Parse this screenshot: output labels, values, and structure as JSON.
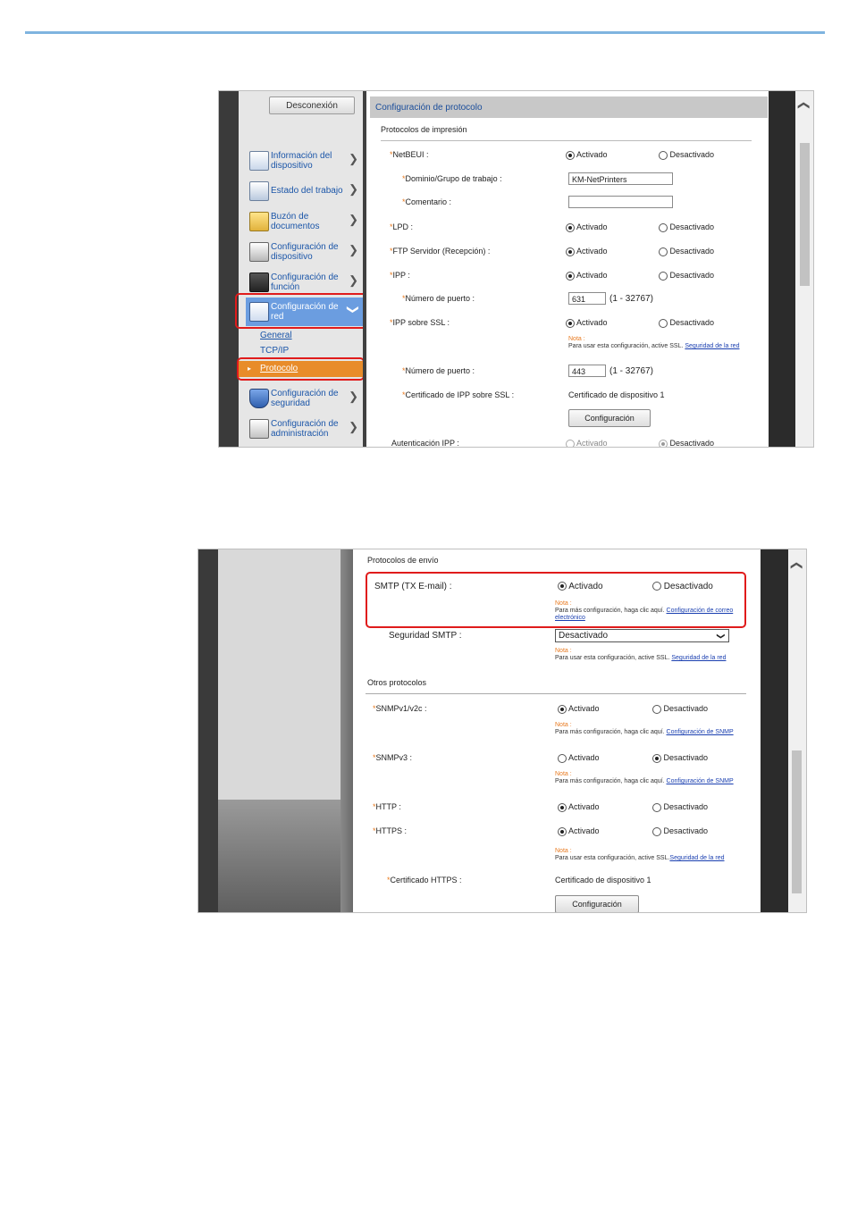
{
  "screenshot1": {
    "sidebar": {
      "logout_label": "Desconexión",
      "items": [
        {
          "label": "Información del dispositivo",
          "icon": "device-info-icon"
        },
        {
          "label": "Estado del trabajo",
          "icon": "job-status-icon"
        },
        {
          "label": "Buzón de documentos",
          "icon": "document-box-icon"
        },
        {
          "label": "Configuración de dispositivo",
          "icon": "device-settings-icon"
        },
        {
          "label": "Configuración de función",
          "icon": "function-settings-icon"
        },
        {
          "label": "Configuración de red",
          "icon": "network-settings-icon"
        },
        {
          "label": "Configuración de seguridad",
          "icon": "security-settings-icon"
        },
        {
          "label": "Configuración de administración",
          "icon": "admin-settings-icon"
        }
      ],
      "subitems": [
        "General",
        "TCP/IP",
        "Protocolo"
      ]
    },
    "main": {
      "title": "Configuración de protocolo",
      "section": "Protocolos de impresión",
      "opt_on": "Activado",
      "opt_off": "Desactivado",
      "rows": {
        "netbeui": "NetBEUI :",
        "domain": "Dominio/Grupo de trabajo :",
        "domain_value": "KM-NetPrinters",
        "comment": "Comentario :",
        "lpd": "LPD :",
        "ftp": "FTP Servidor (Recepción) :",
        "ipp": "IPP :",
        "port": "Número de puerto :",
        "ipp_port_value": "631",
        "port_range": "(1 - 32767)",
        "ipp_ssl": "IPP sobre SSL :",
        "ssl_port_value": "443",
        "cert": "Certificado de IPP sobre SSL :",
        "cert_value": "Certificado de dispositivo 1",
        "config_btn": "Configuración",
        "auth": "Autenticación IPP :"
      },
      "note_label": "Nota :",
      "note_ssl_text": "Para usar esta configuración, active SSL.",
      "note_ssl_link": "Seguridad de la red"
    }
  },
  "screenshot2": {
    "send_section": "Protocolos de envío",
    "smtp": "SMTP (TX E-mail) :",
    "opt_on": "Activado",
    "opt_off": "Desactivado",
    "note_label": "Nota :",
    "note_more_text": "Para más configuración, haga clic aquí.",
    "note_email_link": "Configuración de correo electrónico",
    "smtp_security": "Seguridad SMTP :",
    "smtp_security_value": "Desactivado",
    "note_ssl_text": "Para usar esta configuración, active SSL.",
    "note_ssl_link": "Seguridad de la red",
    "other_section": "Otros protocolos",
    "snmpv1": "SNMPv1/v2c :",
    "note_snmp_link": "Configuración de SNMP",
    "snmpv3": "SNMPv3 :",
    "http": "HTTP :",
    "https": "HTTPS :",
    "https_cert": "Certificado HTTPS :",
    "https_cert_value": "Certificado de dispositivo 1",
    "config_btn": "Configuración"
  },
  "colors": {
    "accent_blue": "#6b9de0",
    "highlight_orange": "#e88c2a",
    "callout_red": "#e01b1b",
    "required_star": "#e87a20"
  }
}
